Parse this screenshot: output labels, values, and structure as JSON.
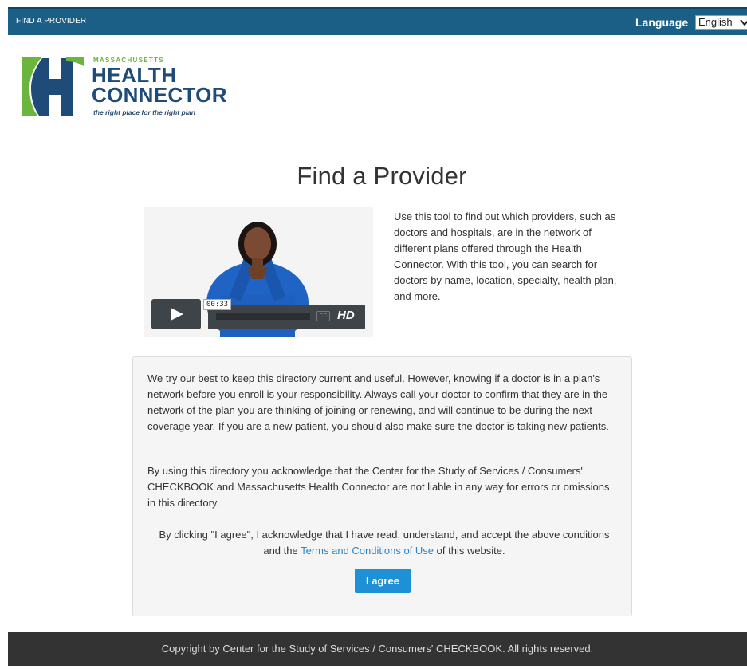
{
  "topbar": {
    "crumb": "FIND A PROVIDER",
    "language_label": "Language",
    "language_selected": "English"
  },
  "logo": {
    "line1": "MASSACHUSETTS",
    "line2": "HEALTH",
    "line3": "CONNECTOR",
    "tagline": "the right place for the right plan",
    "colors": {
      "green": "#6bb53f",
      "navy": "#1e4b78"
    }
  },
  "page": {
    "title": "Find a Provider"
  },
  "video": {
    "timecode": "00:33",
    "hd_label": "HD",
    "icons": [
      "play-icon",
      "closed-captions-icon"
    ]
  },
  "intro": {
    "text": "Use this tool to find out which providers, such as doctors and hospitals, are in the network of different plans offered through the Health Connector. With this tool, you can search for doctors by name, location, specialty, health plan, and more."
  },
  "notice": {
    "paragraph1": "We try our best to keep this directory current and useful. However, knowing if a doctor is in a plan's network before you enroll is your responsibility. Always call your doctor to confirm that they are in the network of the plan you are thinking of joining or renewing, and will continue to be during the next coverage year. If you are a new patient, you should also make sure the doctor is taking new patients.",
    "paragraph2": "By using this directory you acknowledge that the Center for the Study of Services / Consumers' CHECKBOOK and Massachusetts Health Connector are not liable in any way for errors or omissions in this directory.",
    "consent_before": "By clicking \"I agree\", I acknowledge that I have read, understand, and accept the above conditions and the ",
    "terms_link": "Terms and Conditions of Use",
    "consent_after": " of this website.",
    "agree_button": "I agree"
  },
  "footer": {
    "text": "Copyright by Center for the Study of Services / Consumers' CHECKBOOK. All rights reserved."
  },
  "colors": {
    "topbar": "#1b5f87",
    "accent_button": "#1e90d6",
    "link": "#2a85c8",
    "footer": "#333333"
  }
}
